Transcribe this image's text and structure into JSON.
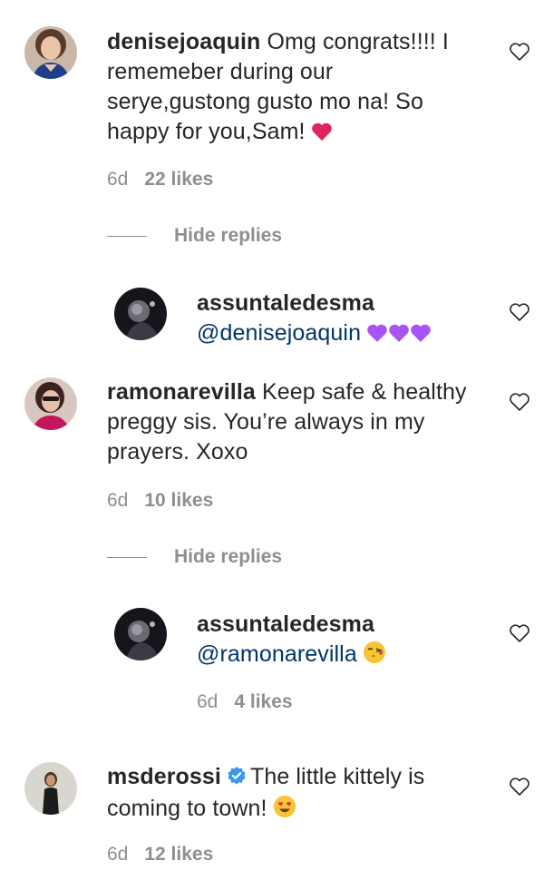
{
  "colors": {
    "text": "#262626",
    "muted": "#8e8e8e",
    "mention": "#003569",
    "verified": "#3897f0",
    "red_heart": "#e0245e",
    "purple_heart": "#a855f7"
  },
  "comments": [
    {
      "username": "denisejoaquin",
      "text_1": "Omg congrats!!!! I",
      "text_2": "rememeber during our",
      "text_3": "serye,gustong gusto mo na! So",
      "text_4": "happy for you,Sam!",
      "emoji": "red-heart",
      "time": "6d",
      "likes": "22 likes",
      "hide_replies": "Hide replies",
      "reply": {
        "username": "assuntaledesma",
        "mention": "@denisejoaquin",
        "emoji": "purple-hearts"
      }
    },
    {
      "username": "ramonarevilla",
      "text_1": "Keep safe & healthy",
      "text_2": "preggy sis. You’re always in my",
      "text_3": "prayers. Xoxo",
      "time": "6d",
      "likes": "10 likes",
      "hide_replies": "Hide replies",
      "reply": {
        "username": "assuntaledesma",
        "mention": "@ramonarevilla",
        "emoji": "kiss-face",
        "time": "6d",
        "likes": "4 likes"
      }
    },
    {
      "username": "msderossi",
      "text_1": "The little kittely is",
      "text_2": "coming to town!",
      "emoji": "heart-eyes-face",
      "time": "6d",
      "likes": "12 likes"
    }
  ]
}
